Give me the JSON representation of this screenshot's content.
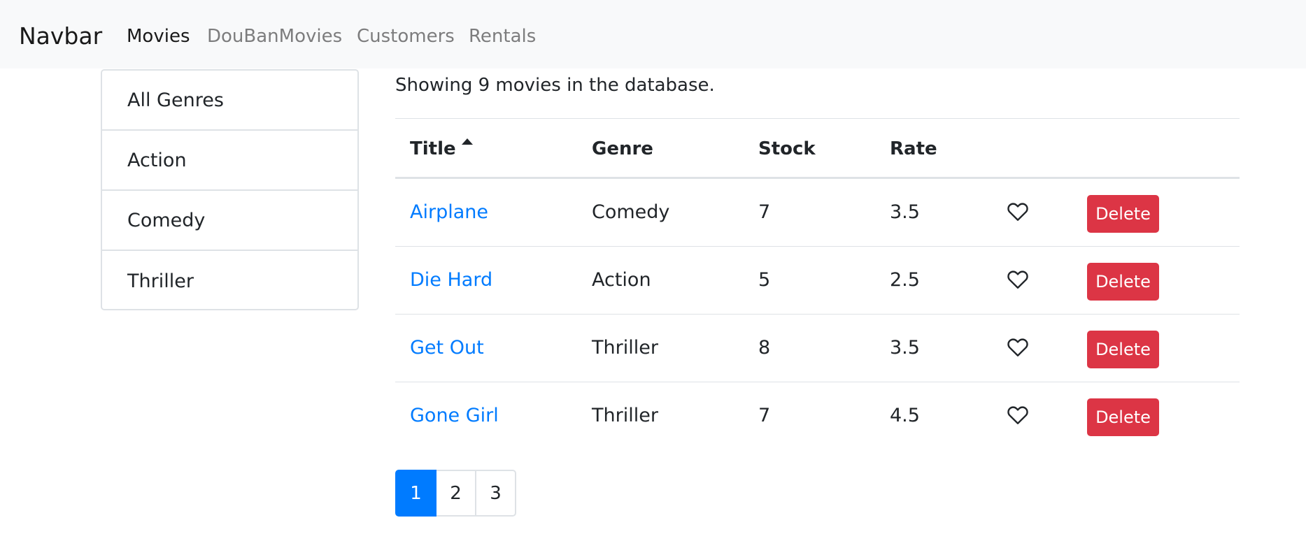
{
  "navbar": {
    "brand": "Navbar",
    "links": [
      {
        "label": "Movies",
        "active": true
      },
      {
        "label": "DouBanMovies",
        "active": false
      },
      {
        "label": "Customers",
        "active": false
      },
      {
        "label": "Rentals",
        "active": false
      }
    ]
  },
  "genres": [
    "All Genres",
    "Action",
    "Comedy",
    "Thriller"
  ],
  "summary": "Showing 9 movies in the database.",
  "table": {
    "headers": {
      "title": "Title",
      "genre": "Genre",
      "stock": "Stock",
      "rate": "Rate"
    },
    "sort_icon": "caret-up-icon",
    "rows": [
      {
        "title": "Airplane",
        "genre": "Comedy",
        "stock": "7",
        "rate": "3.5",
        "liked": false,
        "delete_label": "Delete"
      },
      {
        "title": "Die Hard",
        "genre": "Action",
        "stock": "5",
        "rate": "2.5",
        "liked": false,
        "delete_label": "Delete"
      },
      {
        "title": "Get Out",
        "genre": "Thriller",
        "stock": "8",
        "rate": "3.5",
        "liked": false,
        "delete_label": "Delete"
      },
      {
        "title": "Gone Girl",
        "genre": "Thriller",
        "stock": "7",
        "rate": "4.5",
        "liked": false,
        "delete_label": "Delete"
      }
    ],
    "like_icon": "heart-outline-icon"
  },
  "pagination": {
    "pages": [
      "1",
      "2",
      "3"
    ],
    "current": "1"
  },
  "colors": {
    "navbar_bg": "#f8f9fa",
    "link": "#007bff",
    "danger": "#dc3545",
    "primary": "#007bff",
    "border": "#dee2e6"
  }
}
